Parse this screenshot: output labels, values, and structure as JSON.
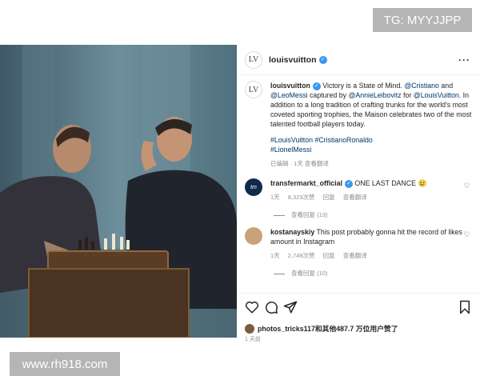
{
  "watermark_top": "TG: MYYJJPP",
  "watermark_bottom": "www.rh918.com",
  "post": {
    "username": "louisvuitton",
    "logo_text": "LV",
    "caption_username": "louisvuitton",
    "caption_pre": " Victory is a State of Mind. ",
    "mention_1": "@Cristiano",
    "caption_and": " and ",
    "mention_2": "@LeoMessi",
    "caption_mid": " captured by ",
    "mention_3": "@AnnieLeibovitz",
    "caption_for": " for ",
    "mention_4": "@LouisVuitton",
    "caption_post": ". In addition to a long tradition of crafting trunks for the world's most coveted sporting trophies, the Maison celebrates two of the most talented football players today.",
    "hashtag_1": "#LouisVuitton",
    "hashtag_2": "#CristianoRonaldo",
    "hashtag_3": "#LionelMessi",
    "caption_meta": "已编辑 · 1天  查看翻译"
  },
  "comments": [
    {
      "username": "transfermarkt_official",
      "text": " ONE LAST DANCE 😢",
      "time": "1天",
      "likes": "8,323次赞",
      "reply": "回复",
      "translate": "查看翻译",
      "replies": "查看回复 (13)",
      "avatar_color": "#0f2a4a",
      "avatar_text": "tm"
    },
    {
      "username": "kostanayskiy",
      "text": " This post probably gonna hit the record of likes amount in Instagram",
      "time": "1天",
      "likes": "2,749次赞",
      "reply": "回复",
      "translate": "查看翻译",
      "replies": "查看回复 (10)",
      "avatar_color": "#c9a27a"
    }
  ],
  "footer": {
    "likes_text": "photos_tricks117和其他487.7 万位用户赞了",
    "time": "1 天前"
  },
  "icons": [
    "heart-icon",
    "comment-icon",
    "share-icon",
    "bookmark-icon",
    "more-icon",
    "verified-icon"
  ]
}
